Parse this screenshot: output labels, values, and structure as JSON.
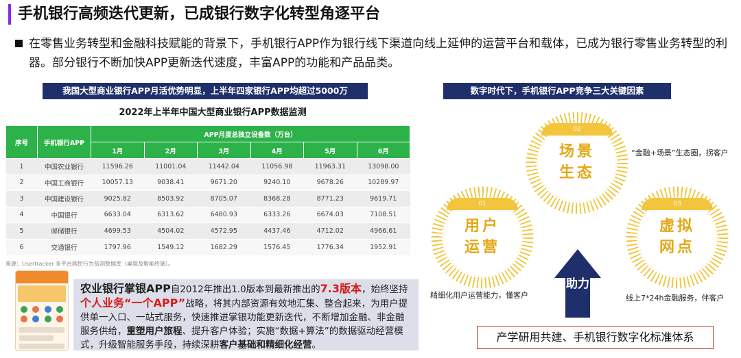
{
  "header": {
    "title": "手机银行高频迭代更新，已成银行数字化转型角逐平台"
  },
  "bullet": {
    "text": "在零售业务转型和金融科技赋能的背景下，手机银行APP作为银行线下渠道向线上延伸的运营平台和载体，已成为银行零售业务转型的利器。部分银行不断加快APP更新迭代速度，丰富APP的功能和产品品类。"
  },
  "left_banner": "我国大型商业银行APP月活优势明显，上半年四家银行APP均超过5000万",
  "right_banner": "数字时代下，手机银行APP竞争三大关键因素",
  "table": {
    "title": "2022年上半年中国大型商业银行APP数据监测",
    "col_seq": "序号",
    "col_app": "手机银行APP",
    "col_group": "APP月度总独立设备数（万台）",
    "months": [
      "1月",
      "2月",
      "3月",
      "4月",
      "5月",
      "6月"
    ],
    "rows": [
      {
        "seq": "1",
        "name": "中国农业银行",
        "values": [
          "11596.26",
          "11001.04",
          "11442.04",
          "11056.98",
          "11963.31",
          "13098.00"
        ]
      },
      {
        "seq": "2",
        "name": "中国工商银行",
        "values": [
          "10057.13",
          "9038.41",
          "9671.20",
          "9240.10",
          "9678.26",
          "10289.97"
        ]
      },
      {
        "seq": "3",
        "name": "中国建设银行",
        "values": [
          "9025.82",
          "8503.92",
          "8705.07",
          "8368.28",
          "8771.23",
          "9619.71"
        ]
      },
      {
        "seq": "4",
        "name": "中国银行",
        "values": [
          "6633.04",
          "6313.62",
          "6480.93",
          "6333.26",
          "6674.03",
          "7108.51"
        ]
      },
      {
        "seq": "5",
        "name": "邮储银行",
        "values": [
          "4699.53",
          "4504.02",
          "4572.95",
          "4437.46",
          "4712.02",
          "4966.61"
        ]
      },
      {
        "seq": "6",
        "name": "交通银行",
        "values": [
          "1797.96",
          "1549.12",
          "1682.29",
          "1576.45",
          "1776.34",
          "1952.91"
        ]
      }
    ],
    "source": "来源：Usertracker 多平台网民行为监测数据库（桌面及智能终端）。"
  },
  "description": {
    "p1_bold": "农业银行掌银APP",
    "p2": "自2012年推出1.0版本到最新推出的",
    "p3_red": "7.3版本",
    "p4": "，始终坚持",
    "p5_red": "个人业务“一个APP”",
    "p6": "战略，将其内部资源有效地汇集、整合起来，为用户提供单一入口、一站式服务，快速推进掌银功能更新迭代，不断增加金融、非金融服务供给，",
    "p7_bold": "重塑用户旅程",
    "p8": "、提升客户体验；实施“数据+算法”的数据驱动经营模式，升级智能服务手段，持续深耕",
    "p9_bold": "客户基础和精细化经营",
    "p10": "。"
  },
  "factors": [
    {
      "num": "01",
      "line1": "用户",
      "line2": "运营",
      "caption": "精细化用户运营能力，懂客户"
    },
    {
      "num": "02",
      "line1": "场景",
      "line2": "生态",
      "caption": "“金融+场景”生态圈，拐客户"
    },
    {
      "num": "03",
      "line1": "虚拟",
      "line2": "网点",
      "caption": "线上7*24h金融服务，伴客户"
    }
  ],
  "arrow_label": "助力",
  "standard_box": "产学研用共建、手机银行数字化标准体系",
  "colors": {
    "accent_purple": "#8a2be2",
    "banner_navy": "#1f2f6b",
    "table_green": "#2db24a",
    "gold": "#f2c53d",
    "red": "#d81b1b"
  }
}
